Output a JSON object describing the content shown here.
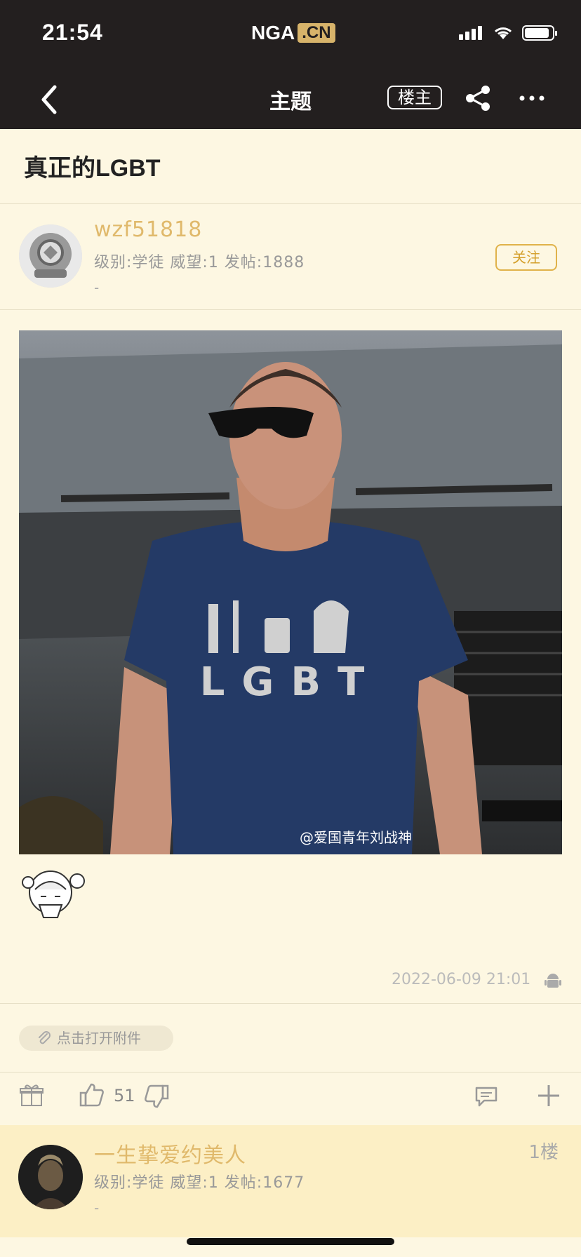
{
  "status_bar": {
    "time": "21:54",
    "logo_text": "NGA",
    "logo_suffix": ".CN"
  },
  "nav": {
    "title": "主题",
    "owner_label": "楼主"
  },
  "thread": {
    "title": "真正的LGBT"
  },
  "author": {
    "username": "wzf51818",
    "meta": "级别:学徒  威望:1  发帖:1888",
    "signature": "-",
    "follow_label": "关注"
  },
  "post": {
    "image_shirt_text": "LGBT",
    "image_watermark": "@爱国青年刘战神",
    "timestamp": "2022-06-09 21:01",
    "attachment_label": "点击打开附件",
    "likes": "51"
  },
  "reply": {
    "username": "一生挚爱约美人",
    "meta": "级别:学徒  威望:1  发帖:1677",
    "signature": "-",
    "floor": "1楼"
  },
  "colors": {
    "topbar": "#231f1f",
    "background": "#fdf7e2",
    "accent": "#e0b96b",
    "reply_band": "#fcefc5"
  }
}
